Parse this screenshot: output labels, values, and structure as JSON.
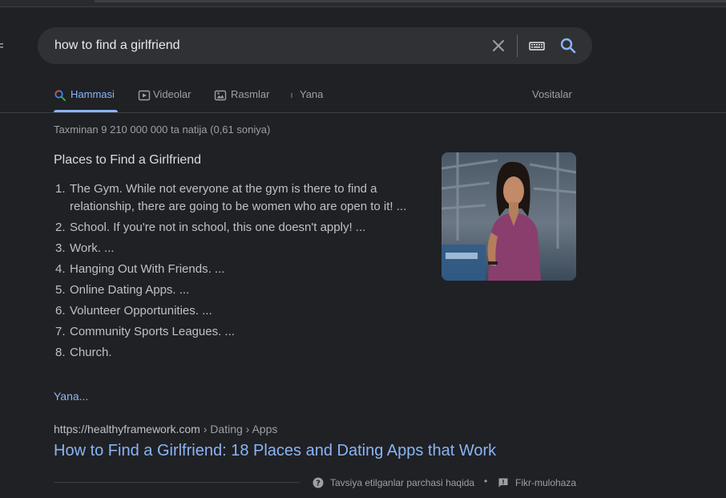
{
  "search": {
    "query": "how to find a girlfriend"
  },
  "tabs": [
    {
      "label": "Hammasi",
      "icon": "search-icon",
      "active": true
    },
    {
      "label": "Videolar",
      "icon": "video-icon"
    },
    {
      "label": "Rasmlar",
      "icon": "image-icon"
    },
    {
      "label": "Yana",
      "icon": "more-vert-icon"
    }
  ],
  "tools_label": "Vositalar",
  "stats": "Taxminan 9 210 000 000 ta natija (0,61 soniya)",
  "snippet": {
    "title": "Places to Find a Girlfriend",
    "items": [
      {
        "num": "1.",
        "text": "The Gym. While not everyone at the gym is there to find a relationship, there are going to be women who are open to it! ..."
      },
      {
        "num": "2.",
        "text": "School. If you're not in school, this one doesn't apply! ..."
      },
      {
        "num": "3.",
        "text": "Work. ..."
      },
      {
        "num": "4.",
        "text": "Hanging Out With Friends. ..."
      },
      {
        "num": "5.",
        "text": "Online Dating Apps. ..."
      },
      {
        "num": "6.",
        "text": "Volunteer Opportunities. ..."
      },
      {
        "num": "7.",
        "text": "Community Sports Leagues. ..."
      },
      {
        "num": "8.",
        "text": "Church."
      }
    ],
    "more_label": "Yana..."
  },
  "result": {
    "url": "https://healthyframework.com",
    "path": " › Dating › Apps",
    "title": "How to Find a Girlfriend: 18 Places and Dating Apps that Work"
  },
  "footer": {
    "about": "Tavsiya etilganlar parchasi haqida",
    "separator": "•",
    "feedback": "Fikr-mulohaza"
  },
  "colors": {
    "background": "#202124",
    "link": "#8ab4f8",
    "searchbox": "#303134"
  }
}
